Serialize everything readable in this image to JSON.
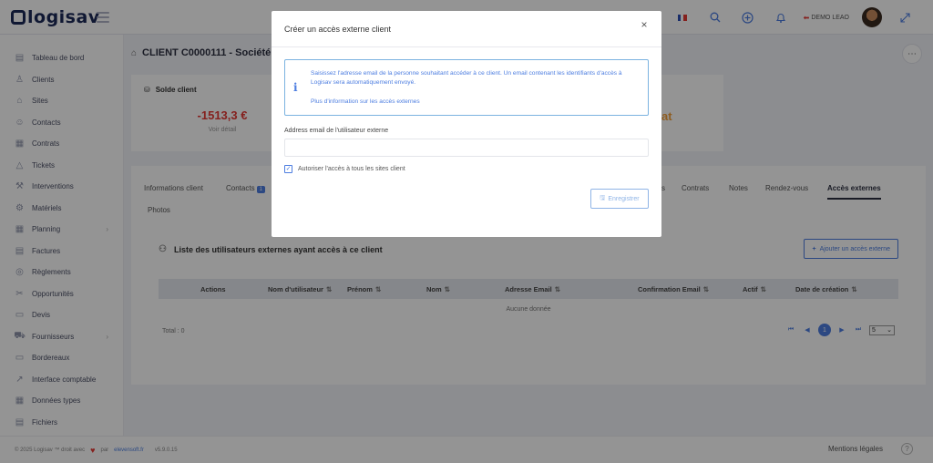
{
  "app": {
    "logo_text": "logisav",
    "user_label": "DEMO LEAO"
  },
  "topbar": {
    "icons": [
      "flag-fr-icon",
      "search-icon",
      "plus-circle-icon",
      "bell-icon",
      "logout-icon",
      "expand-icon"
    ]
  },
  "sidebar": {
    "items": [
      {
        "label": "Tableau de bord",
        "icon": "dashboard-icon"
      },
      {
        "label": "Clients",
        "icon": "clients-icon"
      },
      {
        "label": "Sites",
        "icon": "sites-icon"
      },
      {
        "label": "Contacts",
        "icon": "contacts-icon"
      },
      {
        "label": "Contrats",
        "icon": "contracts-icon"
      },
      {
        "label": "Tickets",
        "icon": "tickets-icon"
      },
      {
        "label": "Interventions",
        "icon": "wrench-icon"
      },
      {
        "label": "Matériels",
        "icon": "gear-icon"
      },
      {
        "label": "Planning",
        "icon": "calendar-icon",
        "has_chevron": true
      },
      {
        "label": "Factures",
        "icon": "invoice-icon"
      },
      {
        "label": "Règlements",
        "icon": "payments-icon"
      },
      {
        "label": "Opportunités",
        "icon": "opportunities-icon"
      },
      {
        "label": "Devis",
        "icon": "quote-icon"
      },
      {
        "label": "Fournisseurs",
        "icon": "suppliers-icon",
        "has_chevron": true
      },
      {
        "label": "Bordereaux",
        "icon": "slips-icon"
      },
      {
        "label": "Interface comptable",
        "icon": "accounting-icon"
      },
      {
        "label": "Données types",
        "icon": "data-icon"
      },
      {
        "label": "Fichiers",
        "icon": "files-icon"
      }
    ]
  },
  "main": {
    "page_title": "CLIENT C0000111 - Société V",
    "solde": {
      "title": "Solde client",
      "value": "-1513,3 €",
      "link": "Voir détail"
    },
    "card2_value": "at",
    "tabs": [
      {
        "label": "Informations client"
      },
      {
        "label": "Contacts",
        "badge": "1"
      },
      {
        "label": "s"
      },
      {
        "label": "Contrats"
      },
      {
        "label": "Notes"
      },
      {
        "label": "Rendez-vous"
      },
      {
        "label": "Accès externes",
        "active": true
      },
      {
        "label": "Photos"
      }
    ],
    "list_title": "Liste des utilisateurs externes ayant accès à ce client",
    "add_button": "Ajouter un accès externe",
    "table": {
      "columns": [
        "Actions",
        "Nom d'utilisateur",
        "Prénom",
        "Nom",
        "Adresse Email",
        "Confirmation Email",
        "Actif",
        "Date de création"
      ],
      "sort_glyph": "⇅",
      "empty_text": "Aucune donnée"
    },
    "total": "Total : 0",
    "pagination": {
      "current_page": "1",
      "page_size": "5"
    }
  },
  "footer": {
    "copyright": "© 2025 Logisav ™ droit avec",
    "par": "par",
    "brand": "elevensoft.fr",
    "version": "v5.9.0.15",
    "mentions": "Mentions légales",
    "help": "?"
  },
  "modal": {
    "title": "Créer un accès externe client",
    "close": "×",
    "info_text": "Saisissez l'adresse email de la personne souhaitant accéder à ce client. Un email contenant les identifiants d'accès à Logisav sera automatiquement envoyé.",
    "info_link": "Plus d'information sur les accès externes",
    "email_label": "Address email de l'utilisateur externe",
    "email_value": "",
    "checkbox_label": "Autoriser l'accès à tous les sites client",
    "checkbox_checked": true,
    "save_label": "Enregistrer"
  },
  "colors": {
    "accent": "#4c7de0",
    "negative": "#e53935",
    "warning": "#f4a03a",
    "logo": "#1c2a59"
  }
}
